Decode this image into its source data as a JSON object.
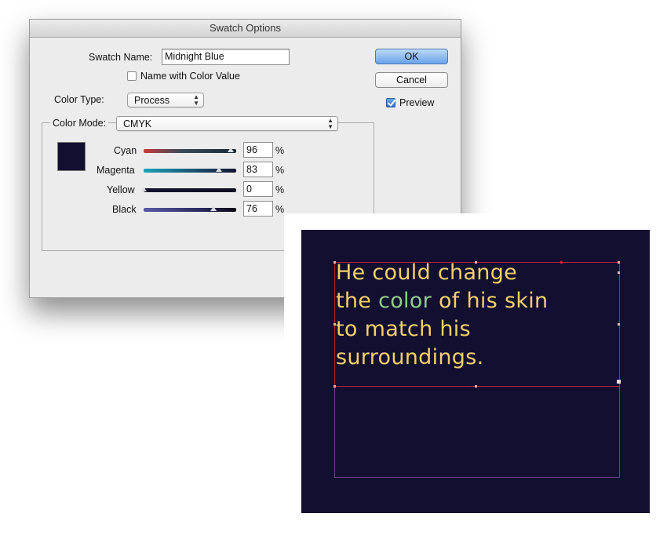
{
  "dialog": {
    "title": "Swatch Options",
    "swatch_name_label": "Swatch Name:",
    "swatch_name_value": "Midnight Blue",
    "name_with_color_value_label": "Name with Color Value",
    "name_with_color_value_checked": false,
    "color_type_label": "Color Type:",
    "color_type_value": "Process",
    "color_mode_label": "Color Mode:",
    "color_mode_value": "CMYK",
    "ok_label": "OK",
    "cancel_label": "Cancel",
    "preview_label": "Preview",
    "preview_checked": true,
    "swatch_color": "#130f31",
    "percent_sign": "%",
    "channels": [
      {
        "label": "Cyan",
        "value": "96"
      },
      {
        "label": "Magenta",
        "value": "83"
      },
      {
        "label": "Yellow",
        "value": "0"
      },
      {
        "label": "Black",
        "value": "76"
      }
    ]
  },
  "canvas": {
    "background_color": "#130f31",
    "text_color": "#f3d069",
    "highlight_color": "#8fcf87",
    "lines": [
      {
        "before": "He could change",
        "highlight": "",
        "after": ""
      },
      {
        "before": "the ",
        "highlight": "color",
        "after": " of his skin"
      },
      {
        "before": "to match his",
        "highlight": "",
        "after": ""
      },
      {
        "before": "surroundings.",
        "highlight": "",
        "after": ""
      }
    ]
  }
}
